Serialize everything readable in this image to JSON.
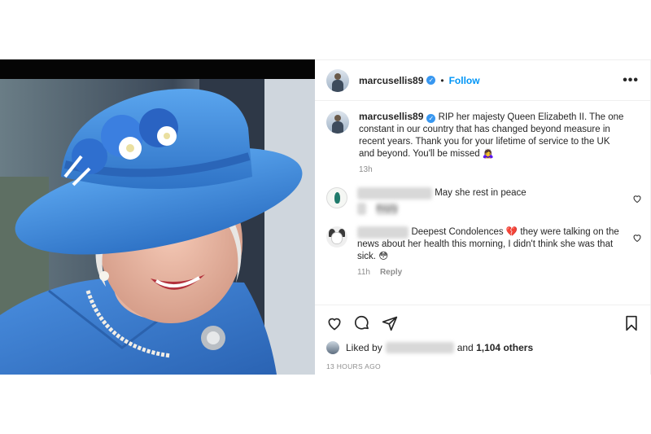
{
  "post": {
    "author": "marcusellis89",
    "follow_label": "Follow",
    "separator": "•",
    "more_label": "•••",
    "image_icon": "photo-queen-blue-hat",
    "caption": "RIP her majesty Queen Elizabeth II. The one constant in our country that has changed beyond measure in recent years. Thank you for your lifetime of service to the UK and beyond. You'll be missed 🙇‍♀️",
    "caption_time": "13h"
  },
  "comments": [
    {
      "author": "blurred-user",
      "author_placeholder": "xxxxxxxxxxxxxxxx",
      "text": "May she rest in peace",
      "time": "4h",
      "reply": "Reply"
    },
    {
      "author": "blurred-user",
      "author_placeholder": "xxxxxxxxxxx",
      "text": "Deepest Condolences 💔 they were talking on the news about her health this morning, I didn't think she was that sick. 😳",
      "time": "11h",
      "reply": "Reply"
    }
  ],
  "actions": {
    "icons": [
      "heart-icon",
      "comment-icon",
      "share-icon",
      "bookmark-icon"
    ]
  },
  "likes": {
    "prefix": "Liked by",
    "user_placeholder": "xxxxxxxxxxxxxx",
    "suffix": "and",
    "others": "1,104 others"
  },
  "timestamp": "13 HOURS AGO",
  "colors": {
    "accent": "#0095f6",
    "hat_blue": "#3f8ad8",
    "verified": "#3897f0"
  }
}
